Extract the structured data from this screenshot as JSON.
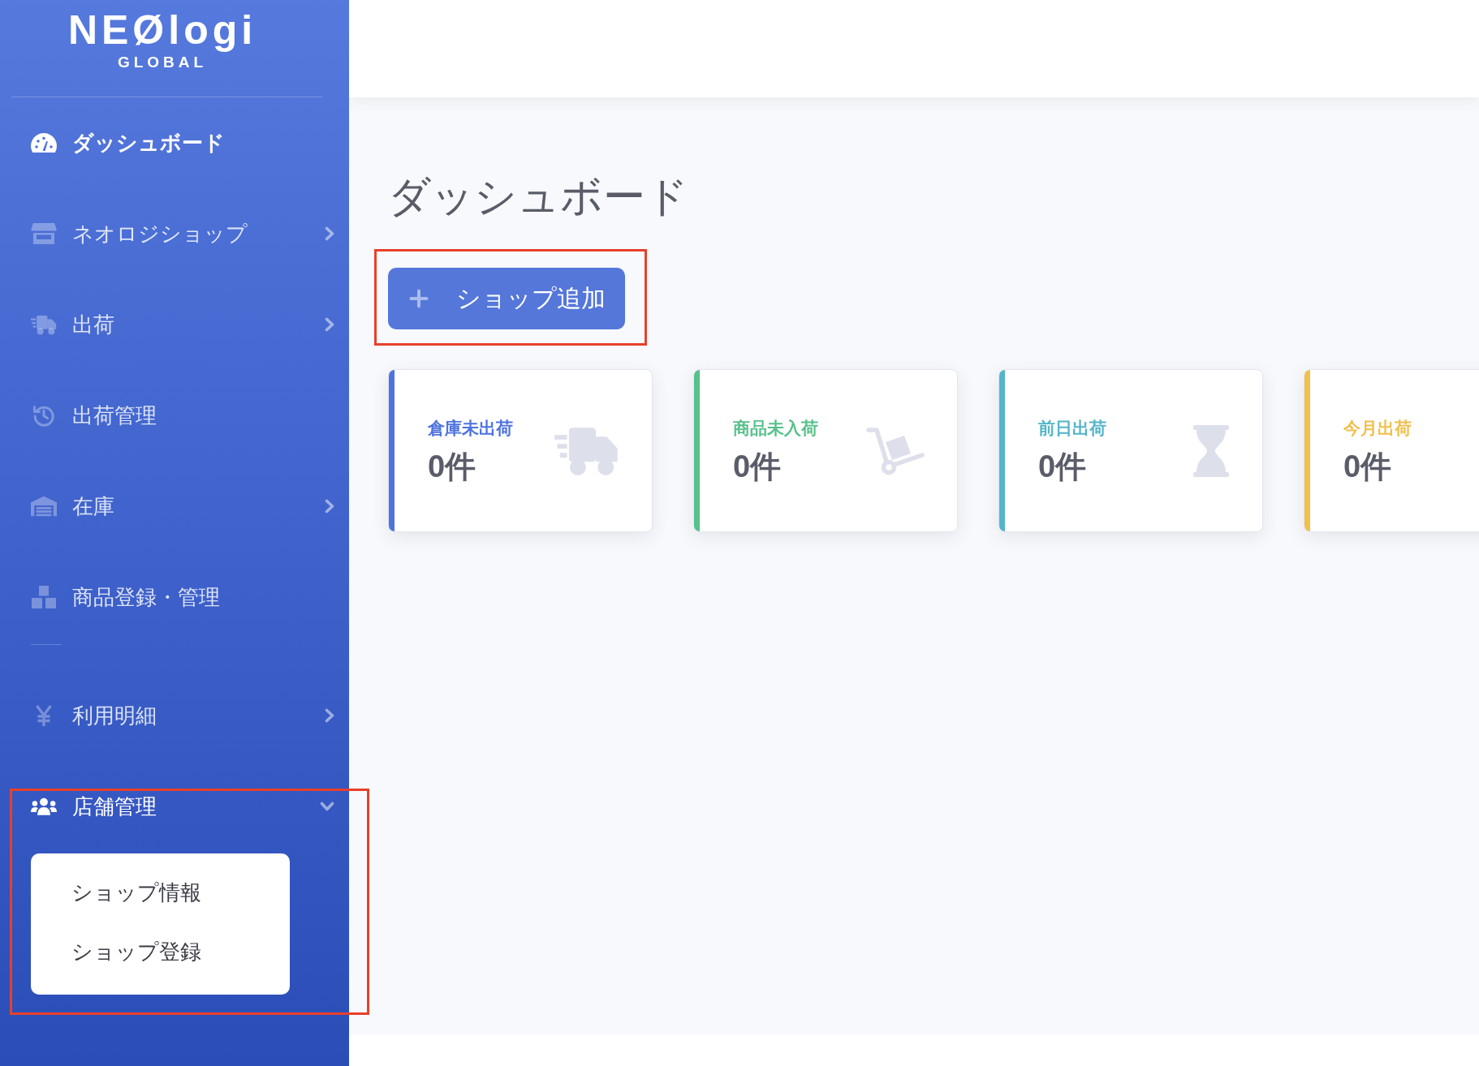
{
  "sidebar": {
    "logo": {
      "wordmark": "NEØlogi",
      "tagline": "GLOBAL"
    },
    "sections": [
      {
        "items": [
          {
            "kind": "link",
            "label": "ダッシュボード",
            "selected": true,
            "highlighted": false
          },
          {
            "kind": "group",
            "label": "ネオロジショップ",
            "selected": false,
            "expanded": false,
            "highlighted": false
          },
          {
            "kind": "group",
            "label": "出荷",
            "selected": false,
            "expanded": false,
            "highlighted": false
          },
          {
            "kind": "link",
            "label": "出荷管理",
            "selected": false,
            "highlighted": false
          },
          {
            "kind": "group",
            "label": "在庫",
            "selected": false,
            "expanded": false,
            "highlighted": false
          },
          {
            "kind": "link",
            "label": "商品登録・管理",
            "selected": false,
            "highlighted": false
          }
        ]
      },
      {
        "items": [
          {
            "kind": "group",
            "label": "利用明細",
            "selected": false,
            "expanded": false,
            "highlighted": false
          },
          {
            "kind": "group",
            "label": "店舗管理",
            "selected": false,
            "expanded": true,
            "highlighted": true,
            "children": [
              {
                "label": "ショップ情報",
                "selected": false
              },
              {
                "label": "ショップ登録",
                "selected": false
              }
            ]
          }
        ]
      }
    ]
  },
  "page": {
    "title": "ダッシュボード",
    "add_button": {
      "label": "ショップ追加",
      "highlighted": true
    },
    "cards": [
      {
        "label": "倉庫未出荷",
        "value": "0件",
        "color": "#4e73df"
      },
      {
        "label": "商品未入荷",
        "value": "0件",
        "color": "#56c18a"
      },
      {
        "label": "前日出荷",
        "value": "0件",
        "color": "#53b5c9"
      },
      {
        "label": "今月出荷",
        "value": "0件",
        "color": "#f0bf4c"
      }
    ]
  }
}
